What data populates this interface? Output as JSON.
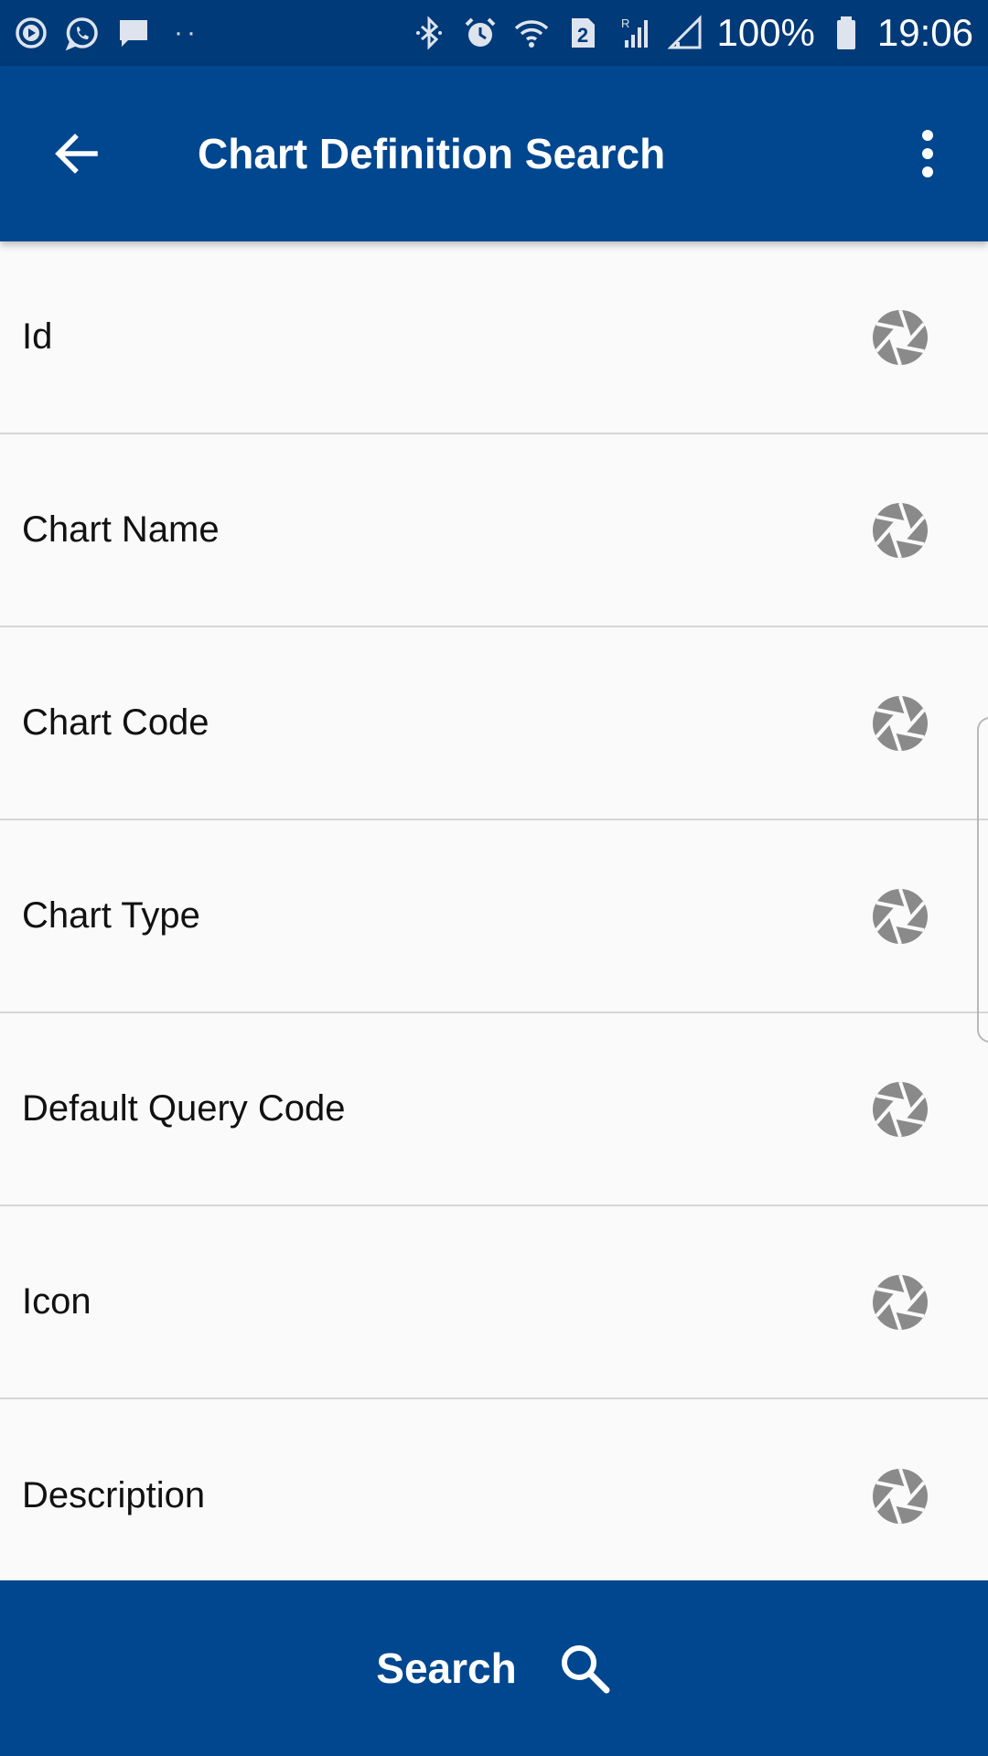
{
  "status_bar": {
    "battery": "100%",
    "time": "19:06",
    "sim_badge": "2",
    "roaming_badge": "R",
    "icons_left": [
      "media-icon",
      "whatsapp-icon",
      "message-icon",
      "more-dots-icon"
    ],
    "icons_right": [
      "bluetooth-icon",
      "alarm-icon",
      "wifi-icon",
      "sim-icon",
      "signal-icon",
      "signal-icon",
      "battery-icon"
    ]
  },
  "app_bar": {
    "title": "Chart Definition Search",
    "back_icon": "back-arrow-icon",
    "menu_icon": "overflow-menu-icon"
  },
  "fields": [
    {
      "label": "Id",
      "icon": "aperture-icon"
    },
    {
      "label": "Chart Name",
      "icon": "aperture-icon"
    },
    {
      "label": "Chart Code",
      "icon": "aperture-icon"
    },
    {
      "label": "Chart Type",
      "icon": "aperture-icon"
    },
    {
      "label": "Default Query Code",
      "icon": "aperture-icon"
    },
    {
      "label": "Icon",
      "icon": "aperture-icon"
    },
    {
      "label": "Description",
      "icon": "aperture-icon"
    }
  ],
  "search_button": {
    "label": "Search",
    "icon": "search-icon"
  },
  "colors": {
    "status_bar": "#003a78",
    "app_bar": "#00478f",
    "background": "#fafafa",
    "divider": "#d6d6d6",
    "icon_gray": "#8a8a8a"
  }
}
